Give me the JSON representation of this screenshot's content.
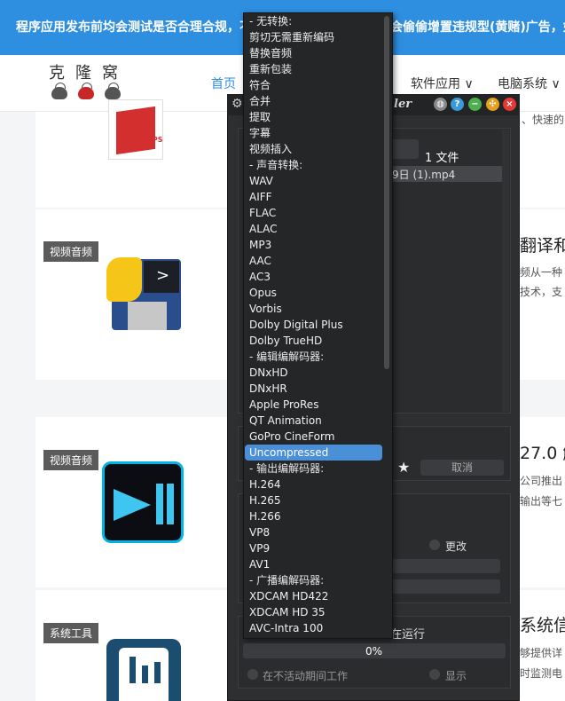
{
  "banner": {
    "text_left": "程序应用发布前均会测试是否合理合规，不",
    "text_right": "会偷偷增置违规型(黄赌)广告，如"
  },
  "site": {
    "logo_text": "克隆窝",
    "nav": {
      "home": "首页",
      "software": "软件应用 ∨",
      "pc_system": "电脑系统 ∨"
    },
    "cards": [
      {
        "tag": "",
        "title": "",
        "desc1": "、快速的"
      },
      {
        "tag": "视频音频",
        "title": "翻译和",
        "desc1": "频从一种",
        "desc2": "技术，支"
      },
      {
        "tag": "视频音频",
        "title": "27.0 解",
        "desc1": "公司推出",
        "desc2": "输出等七"
      },
      {
        "tag": "系统工具",
        "title": "系统信",
        "desc1": "够提供详",
        "desc2": "时监测电"
      }
    ]
  },
  "app": {
    "title_partial": "ler",
    "file_count": "1 文件",
    "file_name": "9日 (1).mp4",
    "cancel_label": "取消",
    "change_label": "更改",
    "running_label": "在运行",
    "progress": "0%",
    "progress_value": 0,
    "work_inactive_label": "在不活动期间工作",
    "show_label": "显示",
    "colors": {
      "accent": "#4a90d9",
      "bg": "#2d2f31",
      "banner": "#2e8ee0"
    }
  },
  "dropdown": {
    "items": [
      {
        "label": "- 无转换:",
        "type": "header"
      },
      {
        "label": "剪切无需重新编码",
        "type": "item"
      },
      {
        "label": "替换音频",
        "type": "item"
      },
      {
        "label": "重新包装",
        "type": "item"
      },
      {
        "label": "符合",
        "type": "item"
      },
      {
        "label": "合并",
        "type": "item"
      },
      {
        "label": "提取",
        "type": "item"
      },
      {
        "label": "字幕",
        "type": "item"
      },
      {
        "label": "视频插入",
        "type": "item"
      },
      {
        "label": "- 声音转换:",
        "type": "header"
      },
      {
        "label": "WAV",
        "type": "item"
      },
      {
        "label": "AIFF",
        "type": "item"
      },
      {
        "label": "FLAC",
        "type": "item"
      },
      {
        "label": "ALAC",
        "type": "item"
      },
      {
        "label": "MP3",
        "type": "item"
      },
      {
        "label": "AAC",
        "type": "item"
      },
      {
        "label": "AC3",
        "type": "item"
      },
      {
        "label": "Opus",
        "type": "item"
      },
      {
        "label": "Vorbis",
        "type": "item"
      },
      {
        "label": "Dolby Digital Plus",
        "type": "item"
      },
      {
        "label": "Dolby TrueHD",
        "type": "item"
      },
      {
        "label": "- 编辑编解码器:",
        "type": "header"
      },
      {
        "label": "DNxHD",
        "type": "item"
      },
      {
        "label": "DNxHR",
        "type": "item"
      },
      {
        "label": "Apple ProRes",
        "type": "item"
      },
      {
        "label": "QT Animation",
        "type": "item"
      },
      {
        "label": "GoPro CineForm",
        "type": "item"
      },
      {
        "label": "Uncompressed",
        "type": "selected"
      },
      {
        "label": "- 输出编解码器:",
        "type": "header"
      },
      {
        "label": "H.264",
        "type": "item"
      },
      {
        "label": "H.265",
        "type": "item"
      },
      {
        "label": "H.266",
        "type": "item"
      },
      {
        "label": "VP8",
        "type": "item"
      },
      {
        "label": "VP9",
        "type": "item"
      },
      {
        "label": "AV1",
        "type": "item"
      },
      {
        "label": "- 广播编解码器:",
        "type": "header"
      },
      {
        "label": "XDCAM HD422",
        "type": "item"
      },
      {
        "label": "XDCAM HD 35",
        "type": "item"
      },
      {
        "label": "AVC-Intra 100",
        "type": "item"
      }
    ]
  }
}
